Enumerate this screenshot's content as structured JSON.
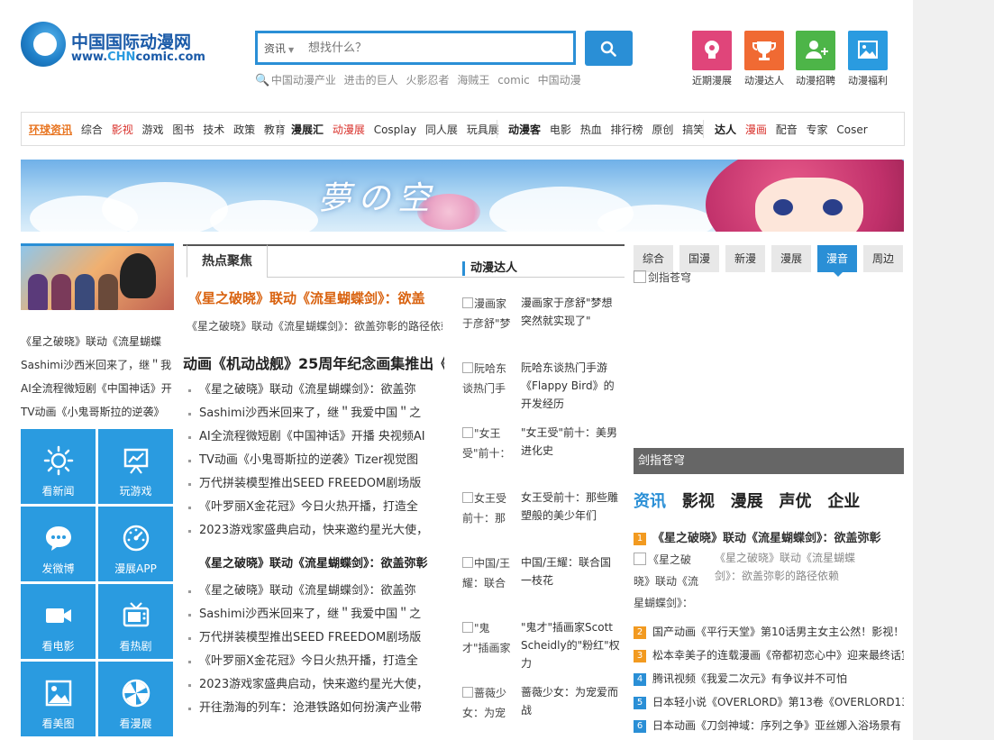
{
  "logo": {
    "cn": "中国国际动漫网",
    "en_pre": "www.",
    "en_mid": "CHN",
    "en_post": "comic.com"
  },
  "search": {
    "category": "资讯",
    "placeholder": "想找什么？"
  },
  "hot_keywords": [
    "中国动漫产业",
    "进击的巨人",
    "火影忍者",
    "海贼王",
    "comic",
    "中国动漫"
  ],
  "quick_links": [
    {
      "label": "近期漫展",
      "color": "#e0457a",
      "icon": "bulb-icon"
    },
    {
      "label": "动漫达人",
      "color": "#f06a33",
      "icon": "trophy-icon"
    },
    {
      "label": "动漫招聘",
      "color": "#4db548",
      "icon": "user-add-icon"
    },
    {
      "label": "动漫福利",
      "color": "#2a9be0",
      "icon": "image-icon"
    }
  ],
  "nav": {
    "g1": {
      "head": "环球资讯",
      "items": [
        "综合",
        "影视",
        "游戏",
        "图书",
        "技术",
        "政策",
        "教育"
      ]
    },
    "g2": {
      "head": "漫展汇",
      "items": [
        "动漫展",
        "Cosplay",
        "同人展",
        "玩具展"
      ]
    },
    "g3": {
      "head": "动漫客",
      "items": [
        "电影",
        "热血",
        "排行榜",
        "原创",
        "搞笑"
      ]
    },
    "g4": {
      "head": "达人",
      "items": [
        "漫画",
        "配音",
        "专家",
        "Coser"
      ]
    }
  },
  "banner": {
    "title": "夢の空"
  },
  "left_news": [
    "《星之破晓》联动《流星蝴蝶",
    "Sashimi沙西米回来了，继＂我",
    "AI全流程微短剧《中国神话》开",
    "TV动画《小鬼哥斯拉的逆袭》"
  ],
  "tiles": [
    {
      "label": "看新闻",
      "icon": "sun-icon"
    },
    {
      "label": "玩游戏",
      "icon": "easel-chart-icon"
    },
    {
      "label": "发微博",
      "icon": "chat-bubble-icon"
    },
    {
      "label": "漫展APP",
      "icon": "gauge-icon"
    },
    {
      "label": "看电影",
      "icon": "video-camera-icon"
    },
    {
      "label": "看热剧",
      "icon": "tv-icon"
    },
    {
      "label": "看美图",
      "icon": "picture-icon"
    },
    {
      "label": "看漫展",
      "icon": "pinwheel-icon"
    }
  ],
  "middle": {
    "tab": "热点聚焦",
    "headline": "《星之破晓》联动《流星蝴蝶剑》：欲盖",
    "subline": "《星之破晓》联动《流星蝴蝶剑》：欲盖弥彰的路径依赖",
    "headline2": "动画《机动战舰》25周年纪念画集推出《",
    "list1": [
      "《星之破晓》联动《流星蝴蝶剑》：欲盖弥",
      "Sashimi沙西米回来了，继＂我爱中国＂之",
      "AI全流程微短剧《中国神话》开播 央视频AI",
      "TV动画《小鬼哥斯拉的逆袭》Tizer视觉图",
      "万代拼装模型推出SEED FREEDOM剧场版",
      "《叶罗丽X金花冠》今日火热开播，打造全",
      "2023游戏家盛典启动，快来邀约星光大使，"
    ],
    "headline3": "《星之破晓》联动《流星蝴蝶剑》：欲盖弥彰",
    "list2": [
      "《星之破晓》联动《流星蝴蝶剑》：欲盖弥",
      "Sashimi沙西米回来了，继＂我爱中国＂之",
      "万代拼装模型推出SEED FREEDOM剧场版",
      "《叶罗丽X金花冠》今日火热开播，打造全",
      "2023游戏家盛典启动，快来邀约星光大使，",
      "开往渤海的列车：沧港铁路如何扮演产业带"
    ]
  },
  "daren": {
    "title": "动漫达人",
    "items": [
      {
        "img": "漫画家于彦舒\"梦",
        "text": "漫画家于彦舒\"梦想突然就实现了\""
      },
      {
        "img": "阮哈东谈热门手",
        "text": "阮哈东谈热门手游《Flappy Bird》的开发经历"
      },
      {
        "img": "\"女王受\"前十：",
        "text": "\"女王受\"前十：美男进化史"
      },
      {
        "img": "女王受前十：那",
        "text": "女王受前十：那些雕塑般的美少年们"
      },
      {
        "img": "中国/王耀：联合",
        "text": "中国/王耀：联合国一枝花"
      },
      {
        "img": "\"鬼才\"插画家",
        "text": "\"鬼才\"插画家Scott Scheidly的\"粉红\"权力"
      },
      {
        "img": "蔷薇少女：为宠",
        "text": "蔷薇少女：为宠爱而战"
      }
    ]
  },
  "right": {
    "tabs": [
      "综合",
      "国漫",
      "新漫",
      "漫展",
      "漫音",
      "周边"
    ],
    "active_tab": "漫音",
    "image_alt": "剑指苍穹",
    "caption": "剑指苍穹",
    "categories": [
      "资讯",
      "影视",
      "漫展",
      "声优",
      "企业"
    ],
    "first": {
      "num": "1",
      "title": "《星之破晓》联动《流星蝴蝶剑》：欲盖弥彰"
    },
    "first_img": "《星之破晓》联动《流星蝴蝶剑》：",
    "first_desc": "《星之破晓》联动《流星蝴蝶剑》：欲盖弥彰的路径依赖",
    "list": [
      {
        "num": "2",
        "text": "国产动画《平行天堂》第10话男主女主公然！影视！"
      },
      {
        "num": "3",
        "text": "松本幸美子的连载漫画《帝都初恋心中》迎来最终话宣"
      },
      {
        "num": "4",
        "text": "腾讯视频《我爱二次元》有争议并不可怕"
      },
      {
        "num": "5",
        "text": "日本轻小说《OVERLORD》第13卷《OVERLORD13"
      },
      {
        "num": "6",
        "text": "日本动画《刀剑神域：序列之争》亚丝娜入浴场景有"
      }
    ]
  }
}
